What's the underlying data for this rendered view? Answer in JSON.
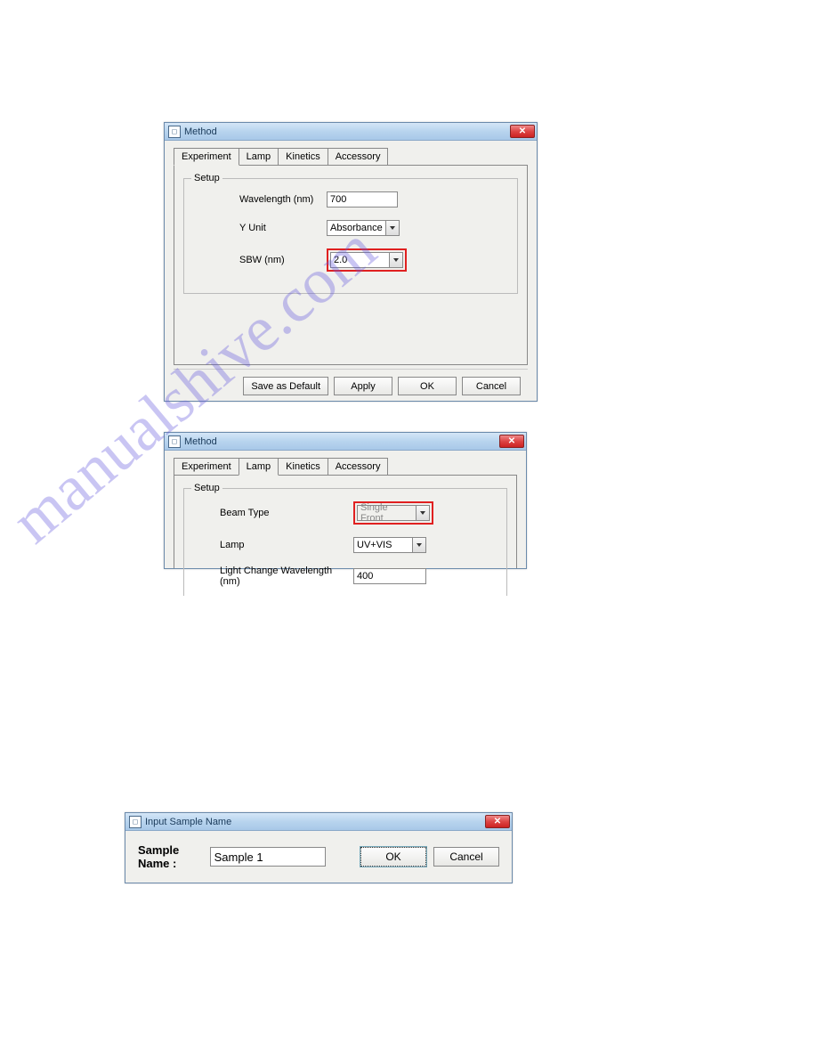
{
  "dialog1": {
    "title": "Method",
    "tabs": [
      "Experiment",
      "Lamp",
      "Kinetics",
      "Accessory"
    ],
    "activeTab": "Experiment",
    "group": "Setup",
    "fields": {
      "wavelength_label": "Wavelength (nm)",
      "wavelength_value": "700",
      "yunit_label": "Y Unit",
      "yunit_value": "Absorbance",
      "sbw_label": "SBW (nm)",
      "sbw_value": "2.0"
    },
    "buttons": {
      "save": "Save as Default",
      "apply": "Apply",
      "ok": "OK",
      "cancel": "Cancel"
    }
  },
  "dialog2": {
    "title": "Method",
    "tabs": [
      "Experiment",
      "Lamp",
      "Kinetics",
      "Accessory"
    ],
    "activeTab": "Lamp",
    "group": "Setup",
    "fields": {
      "beam_label": "Beam Type",
      "beam_value": "Single Front",
      "lamp_label": "Lamp",
      "lamp_value": "UV+VIS",
      "lcw_label": "Light Change Wavelength (nm)",
      "lcw_value": "400"
    }
  },
  "dialog3": {
    "title": "Input Sample Name",
    "label": "Sample Name :",
    "value": "Sample 1",
    "ok": "OK",
    "cancel": "Cancel"
  },
  "watermark": "manualshive.com"
}
